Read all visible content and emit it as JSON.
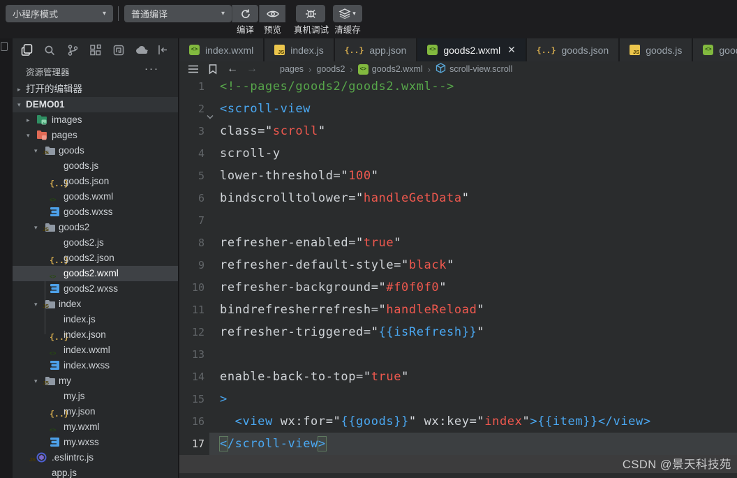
{
  "toolbar": {
    "mode_select": "小程序模式",
    "compile_select": "普通编译",
    "compile_label": "编译",
    "preview_label": "预览",
    "device_debug_label": "真机调试",
    "clear_cache_label": "清缓存"
  },
  "sidebar": {
    "title": "资源管理器",
    "more_glyph": "···",
    "tree": [
      {
        "label": "打开的编辑器",
        "level": 0,
        "arrow": "right",
        "icon": "none"
      },
      {
        "label": "DEMO01",
        "level": 0,
        "arrow": "down",
        "icon": "none",
        "bold": true,
        "hl": true
      },
      {
        "label": "images",
        "level": 1,
        "arrow": "right",
        "icon": "folder-images"
      },
      {
        "label": "pages",
        "level": 1,
        "arrow": "down",
        "icon": "folder-pages"
      },
      {
        "label": "goods",
        "level": 2,
        "arrow": "down",
        "icon": "folder"
      },
      {
        "label": "goods.js",
        "level": 3,
        "icon": "js"
      },
      {
        "label": "goods.json",
        "level": 3,
        "icon": "json"
      },
      {
        "label": "goods.wxml",
        "level": 3,
        "icon": "wxml"
      },
      {
        "label": "goods.wxss",
        "level": 3,
        "icon": "wxss"
      },
      {
        "label": "goods2",
        "level": 2,
        "arrow": "down",
        "icon": "folder"
      },
      {
        "label": "goods2.js",
        "level": 3,
        "icon": "js"
      },
      {
        "label": "goods2.json",
        "level": 3,
        "icon": "json"
      },
      {
        "label": "goods2.wxml",
        "level": 3,
        "icon": "wxml",
        "selected": true
      },
      {
        "label": "goods2.wxss",
        "level": 3,
        "icon": "wxss"
      },
      {
        "label": "index",
        "level": 2,
        "arrow": "down",
        "icon": "folder"
      },
      {
        "label": "index.js",
        "level": 3,
        "icon": "js"
      },
      {
        "label": "index.json",
        "level": 3,
        "icon": "json"
      },
      {
        "label": "index.wxml",
        "level": 3,
        "icon": "wxml"
      },
      {
        "label": "index.wxss",
        "level": 3,
        "icon": "wxss"
      },
      {
        "label": "my",
        "level": 2,
        "arrow": "down",
        "icon": "folder"
      },
      {
        "label": "my.js",
        "level": 3,
        "icon": "js"
      },
      {
        "label": "my.json",
        "level": 3,
        "icon": "json"
      },
      {
        "label": "my.wxml",
        "level": 3,
        "icon": "wxml"
      },
      {
        "label": "my.wxss",
        "level": 3,
        "icon": "wxss"
      },
      {
        "label": ".eslintrc.js",
        "level": 1,
        "icon": "eslint"
      },
      {
        "label": "app.js",
        "level": 1,
        "icon": "js"
      }
    ]
  },
  "tabs": [
    {
      "label": "index.wxml",
      "icon": "wxml",
      "active": false
    },
    {
      "label": "index.js",
      "icon": "js",
      "active": false
    },
    {
      "label": "app.json",
      "icon": "json",
      "active": false
    },
    {
      "label": "goods2.wxml",
      "icon": "wxml",
      "active": true,
      "closable": true
    },
    {
      "label": "goods.json",
      "icon": "json",
      "active": false
    },
    {
      "label": "goods.js",
      "icon": "js",
      "active": false
    },
    {
      "label": "goods.wxml",
      "icon": "wxml",
      "active": false
    }
  ],
  "breadcrumb": [
    {
      "label": "pages",
      "icon": "none"
    },
    {
      "label": "goods2",
      "icon": "none"
    },
    {
      "label": "goods2.wxml",
      "icon": "wxml"
    },
    {
      "label": "scroll-view.scroll",
      "icon": "cube"
    }
  ],
  "editor": {
    "lines": [
      {
        "num": 1,
        "tokens": [
          [
            "<!--pages/goods2/goods2.wxml-->",
            "cm"
          ]
        ]
      },
      {
        "num": 2,
        "fold": true,
        "tokens": [
          [
            "<scroll-view",
            "tag"
          ]
        ]
      },
      {
        "num": 3,
        "tokens": [
          [
            "class=",
            "attr"
          ],
          [
            "\"",
            "q"
          ],
          [
            "scroll",
            "val"
          ],
          [
            "\"",
            "q"
          ]
        ]
      },
      {
        "num": 4,
        "tokens": [
          [
            "scroll-y",
            "attr"
          ]
        ]
      },
      {
        "num": 5,
        "tokens": [
          [
            "lower-threshold=",
            "attr"
          ],
          [
            "\"",
            "q"
          ],
          [
            "100",
            "val"
          ],
          [
            "\"",
            "q"
          ]
        ]
      },
      {
        "num": 6,
        "tokens": [
          [
            "bindscrolltolower=",
            "attr"
          ],
          [
            "\"",
            "q"
          ],
          [
            "handleGetData",
            "val"
          ],
          [
            "\"",
            "q"
          ]
        ]
      },
      {
        "num": 7,
        "tokens": []
      },
      {
        "num": 8,
        "tokens": [
          [
            "refresher-enabled=",
            "attr"
          ],
          [
            "\"",
            "q"
          ],
          [
            "true",
            "val"
          ],
          [
            "\"",
            "q"
          ]
        ]
      },
      {
        "num": 9,
        "tokens": [
          [
            "refresher-default-style=",
            "attr"
          ],
          [
            "\"",
            "q"
          ],
          [
            "black",
            "val"
          ],
          [
            "\"",
            "q"
          ]
        ]
      },
      {
        "num": 10,
        "tokens": [
          [
            "refresher-background=",
            "attr"
          ],
          [
            "\"",
            "q"
          ],
          [
            "#f0f0f0",
            "val"
          ],
          [
            "\"",
            "q"
          ]
        ]
      },
      {
        "num": 11,
        "tokens": [
          [
            "bindrefresherrefresh=",
            "attr"
          ],
          [
            "\"",
            "q"
          ],
          [
            "handleReload",
            "val"
          ],
          [
            "\"",
            "q"
          ]
        ]
      },
      {
        "num": 12,
        "tokens": [
          [
            "refresher-triggered=",
            "attr"
          ],
          [
            "\"",
            "q"
          ],
          [
            "{{isRefresh}}",
            "in"
          ],
          [
            "\"",
            "q"
          ]
        ]
      },
      {
        "num": 13,
        "tokens": []
      },
      {
        "num": 14,
        "tokens": [
          [
            "enable-back-to-top=",
            "attr"
          ],
          [
            "\"",
            "q"
          ],
          [
            "true",
            "val"
          ],
          [
            "\"",
            "q"
          ]
        ]
      },
      {
        "num": 15,
        "tokens": [
          [
            ">",
            "tag"
          ]
        ]
      },
      {
        "num": 16,
        "tokens": [
          [
            "  ",
            "pl"
          ],
          [
            "<view",
            "tag"
          ],
          [
            " wx:for=",
            "attr"
          ],
          [
            "\"",
            "q"
          ],
          [
            "{{goods}}",
            "in"
          ],
          [
            "\"",
            "q"
          ],
          [
            " wx:key=",
            "attr"
          ],
          [
            "\"",
            "q"
          ],
          [
            "index",
            "val"
          ],
          [
            "\"",
            "q"
          ],
          [
            ">",
            "tag"
          ],
          [
            "{{item}}",
            "in"
          ],
          [
            "</view>",
            "tag"
          ]
        ]
      },
      {
        "num": 17,
        "current": true,
        "tokens": [
          [
            "<",
            "tag bk"
          ],
          [
            "/scroll-view",
            "tag"
          ],
          [
            ">",
            "tag bk"
          ]
        ]
      }
    ]
  },
  "watermark": "CSDN @景天科技苑",
  "colors": {
    "accent_blue": "#4aa8f2",
    "value_red": "#ee584e",
    "comment_green": "#57a64a",
    "wxml_green": "#82b93f",
    "js_yellow": "#ecc64d",
    "wxss_blue": "#4da0e8"
  }
}
